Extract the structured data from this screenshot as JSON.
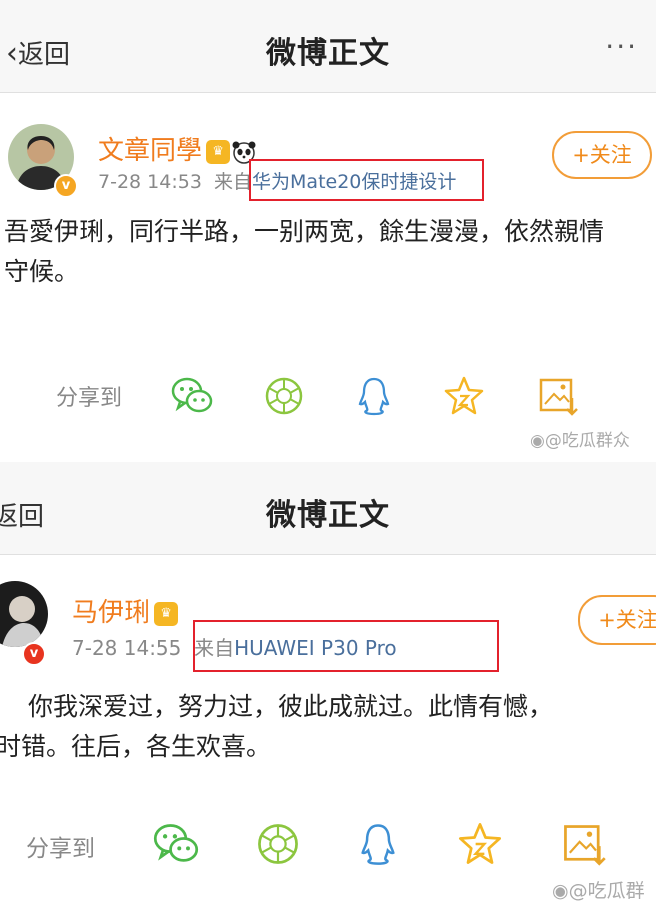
{
  "posts": [
    {
      "header": {
        "back_label": "返回",
        "title": "微博正文",
        "more": "···"
      },
      "user": {
        "name": "文章同學"
      },
      "meta": {
        "time": "7-28 14:53",
        "from_prefix": "来自",
        "source": "华为Mate20保时捷设计"
      },
      "follow_label": "+关注",
      "text": [
        "吾愛伊琍，同行半路，一别两宽，餘生漫漫，依然親情",
        "守候。"
      ],
      "share_label": "分享到",
      "watermark": "@吃瓜群众"
    },
    {
      "header": {
        "back_label": "返回",
        "title": "微博正文"
      },
      "user": {
        "name": "马伊琍"
      },
      "meta": {
        "time": "7-28 14:55",
        "from_prefix": "来自",
        "source": "HUAWEI P30 Pro"
      },
      "follow_label": "+关注",
      "text": [
        "你我深爱过，努力过，彼此成就过。此情有憾，",
        "时错。往后，各生欢喜。"
      ],
      "share_label": "分享到",
      "watermark": "@吃瓜群"
    }
  ],
  "colors": {
    "username": "#f07c1e",
    "source_link": "#4a6f9c",
    "highlight_box": "#e3212c",
    "follow_border": "#f29d38",
    "wechat": "#4cb84a",
    "moments": "#8cc63f",
    "qq": "#3d8fd4",
    "favorite": "#f5b623",
    "save": "#e8a52a"
  },
  "icons": [
    "wechat-icon",
    "moments-icon",
    "qq-icon",
    "favorite-icon",
    "save-image-icon"
  ]
}
